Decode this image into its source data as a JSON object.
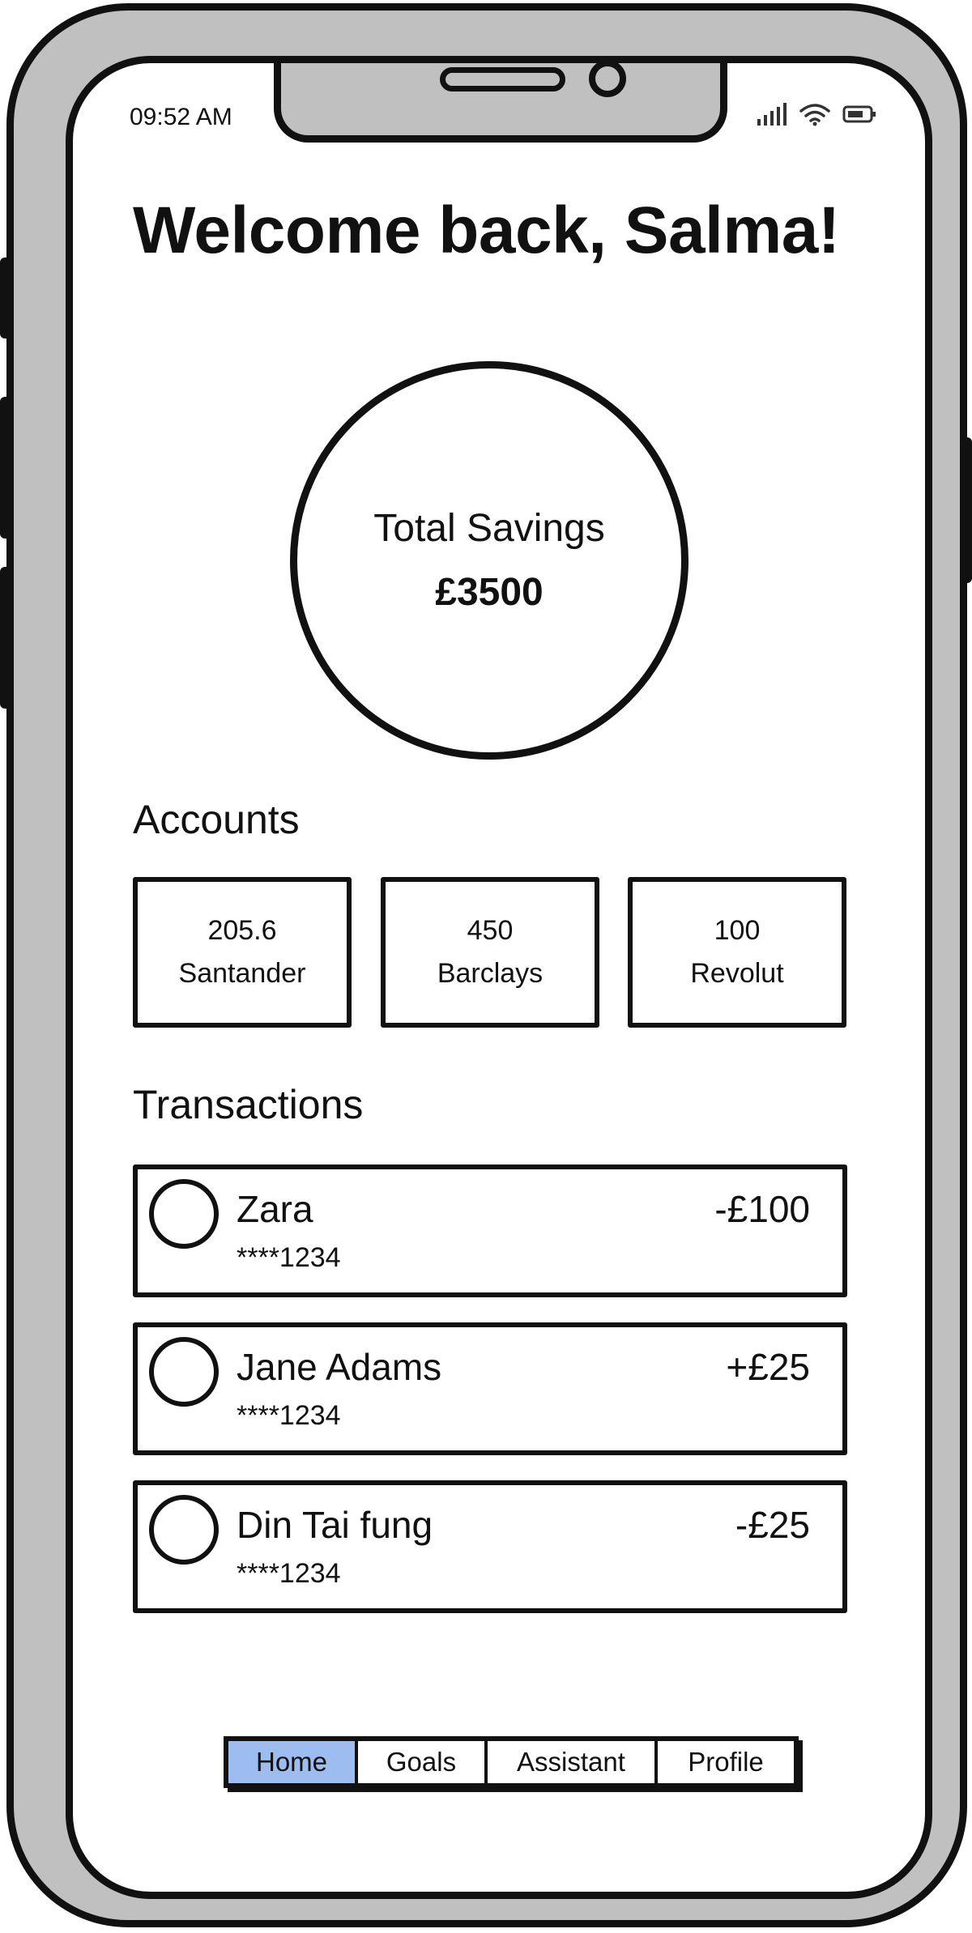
{
  "status_bar": {
    "time": "09:52 AM",
    "icons": [
      "signal-icon",
      "wifi-icon",
      "battery-icon"
    ]
  },
  "greeting": "Welcome back, Salma!",
  "savings": {
    "label": "Total Savings",
    "amount": "£3500"
  },
  "accounts": {
    "title": "Accounts",
    "items": [
      {
        "amount": "205.6",
        "name": "Santander"
      },
      {
        "amount": "450",
        "name": "Barclays"
      },
      {
        "amount": "100",
        "name": "Revolut"
      }
    ]
  },
  "transactions": {
    "title": "Transactions",
    "items": [
      {
        "name": "Zara",
        "card": "****1234",
        "amount": "-£100"
      },
      {
        "name": "Jane Adams",
        "card": "****1234",
        "amount": "+£25"
      },
      {
        "name": "Din Tai fung",
        "card": "****1234",
        "amount": "-£25"
      }
    ]
  },
  "tabs": {
    "active": "Home",
    "active_color": "#9dbcf0",
    "items": [
      "Home",
      "Goals",
      "Assistant",
      "Profile"
    ]
  }
}
